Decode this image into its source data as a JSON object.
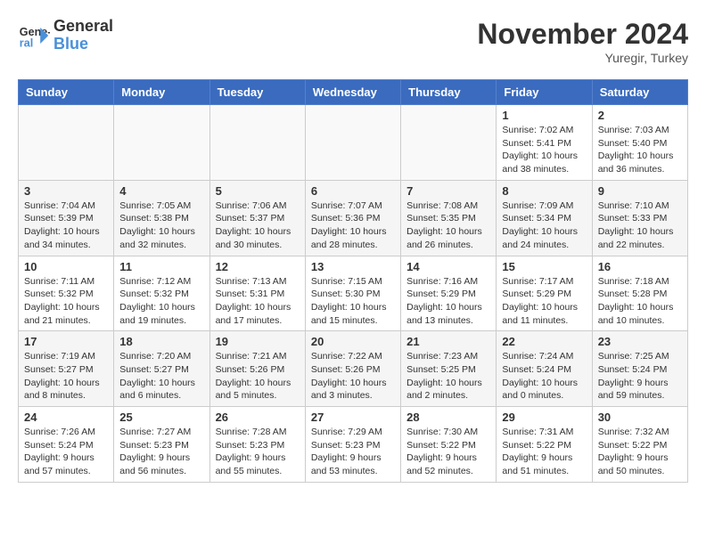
{
  "header": {
    "logo": {
      "line1": "General",
      "line2": "Blue"
    },
    "title": "November 2024",
    "subtitle": "Yuregir, Turkey"
  },
  "weekdays": [
    "Sunday",
    "Monday",
    "Tuesday",
    "Wednesday",
    "Thursday",
    "Friday",
    "Saturday"
  ],
  "weeks": [
    [
      {
        "day": "",
        "info": ""
      },
      {
        "day": "",
        "info": ""
      },
      {
        "day": "",
        "info": ""
      },
      {
        "day": "",
        "info": ""
      },
      {
        "day": "",
        "info": ""
      },
      {
        "day": "1",
        "info": "Sunrise: 7:02 AM\nSunset: 5:41 PM\nDaylight: 10 hours\nand 38 minutes."
      },
      {
        "day": "2",
        "info": "Sunrise: 7:03 AM\nSunset: 5:40 PM\nDaylight: 10 hours\nand 36 minutes."
      }
    ],
    [
      {
        "day": "3",
        "info": "Sunrise: 7:04 AM\nSunset: 5:39 PM\nDaylight: 10 hours\nand 34 minutes."
      },
      {
        "day": "4",
        "info": "Sunrise: 7:05 AM\nSunset: 5:38 PM\nDaylight: 10 hours\nand 32 minutes."
      },
      {
        "day": "5",
        "info": "Sunrise: 7:06 AM\nSunset: 5:37 PM\nDaylight: 10 hours\nand 30 minutes."
      },
      {
        "day": "6",
        "info": "Sunrise: 7:07 AM\nSunset: 5:36 PM\nDaylight: 10 hours\nand 28 minutes."
      },
      {
        "day": "7",
        "info": "Sunrise: 7:08 AM\nSunset: 5:35 PM\nDaylight: 10 hours\nand 26 minutes."
      },
      {
        "day": "8",
        "info": "Sunrise: 7:09 AM\nSunset: 5:34 PM\nDaylight: 10 hours\nand 24 minutes."
      },
      {
        "day": "9",
        "info": "Sunrise: 7:10 AM\nSunset: 5:33 PM\nDaylight: 10 hours\nand 22 minutes."
      }
    ],
    [
      {
        "day": "10",
        "info": "Sunrise: 7:11 AM\nSunset: 5:32 PM\nDaylight: 10 hours\nand 21 minutes."
      },
      {
        "day": "11",
        "info": "Sunrise: 7:12 AM\nSunset: 5:32 PM\nDaylight: 10 hours\nand 19 minutes."
      },
      {
        "day": "12",
        "info": "Sunrise: 7:13 AM\nSunset: 5:31 PM\nDaylight: 10 hours\nand 17 minutes."
      },
      {
        "day": "13",
        "info": "Sunrise: 7:15 AM\nSunset: 5:30 PM\nDaylight: 10 hours\nand 15 minutes."
      },
      {
        "day": "14",
        "info": "Sunrise: 7:16 AM\nSunset: 5:29 PM\nDaylight: 10 hours\nand 13 minutes."
      },
      {
        "day": "15",
        "info": "Sunrise: 7:17 AM\nSunset: 5:29 PM\nDaylight: 10 hours\nand 11 minutes."
      },
      {
        "day": "16",
        "info": "Sunrise: 7:18 AM\nSunset: 5:28 PM\nDaylight: 10 hours\nand 10 minutes."
      }
    ],
    [
      {
        "day": "17",
        "info": "Sunrise: 7:19 AM\nSunset: 5:27 PM\nDaylight: 10 hours\nand 8 minutes."
      },
      {
        "day": "18",
        "info": "Sunrise: 7:20 AM\nSunset: 5:27 PM\nDaylight: 10 hours\nand 6 minutes."
      },
      {
        "day": "19",
        "info": "Sunrise: 7:21 AM\nSunset: 5:26 PM\nDaylight: 10 hours\nand 5 minutes."
      },
      {
        "day": "20",
        "info": "Sunrise: 7:22 AM\nSunset: 5:26 PM\nDaylight: 10 hours\nand 3 minutes."
      },
      {
        "day": "21",
        "info": "Sunrise: 7:23 AM\nSunset: 5:25 PM\nDaylight: 10 hours\nand 2 minutes."
      },
      {
        "day": "22",
        "info": "Sunrise: 7:24 AM\nSunset: 5:24 PM\nDaylight: 10 hours\nand 0 minutes."
      },
      {
        "day": "23",
        "info": "Sunrise: 7:25 AM\nSunset: 5:24 PM\nDaylight: 9 hours\nand 59 minutes."
      }
    ],
    [
      {
        "day": "24",
        "info": "Sunrise: 7:26 AM\nSunset: 5:24 PM\nDaylight: 9 hours\nand 57 minutes."
      },
      {
        "day": "25",
        "info": "Sunrise: 7:27 AM\nSunset: 5:23 PM\nDaylight: 9 hours\nand 56 minutes."
      },
      {
        "day": "26",
        "info": "Sunrise: 7:28 AM\nSunset: 5:23 PM\nDaylight: 9 hours\nand 55 minutes."
      },
      {
        "day": "27",
        "info": "Sunrise: 7:29 AM\nSunset: 5:23 PM\nDaylight: 9 hours\nand 53 minutes."
      },
      {
        "day": "28",
        "info": "Sunrise: 7:30 AM\nSunset: 5:22 PM\nDaylight: 9 hours\nand 52 minutes."
      },
      {
        "day": "29",
        "info": "Sunrise: 7:31 AM\nSunset: 5:22 PM\nDaylight: 9 hours\nand 51 minutes."
      },
      {
        "day": "30",
        "info": "Sunrise: 7:32 AM\nSunset: 5:22 PM\nDaylight: 9 hours\nand 50 minutes."
      }
    ]
  ]
}
